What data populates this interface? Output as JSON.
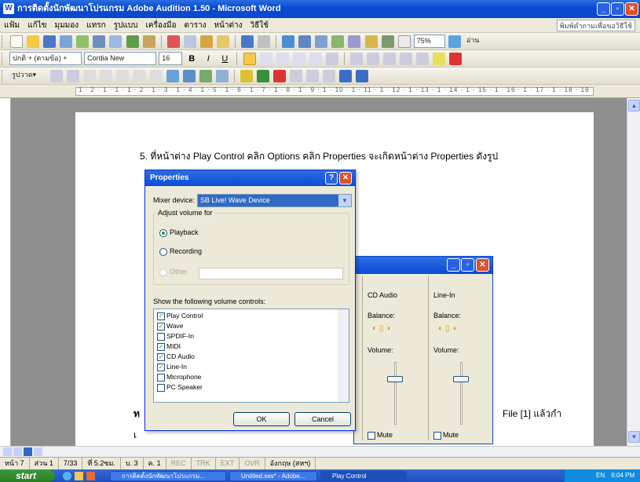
{
  "window": {
    "title": "การติดตั้งนักพัฒนาโปรแกรม Adobe Audition 1.50 - Microsoft Word",
    "help_box": "พิมพ์คำถามเพื่อขอวิธีใช้"
  },
  "menu": [
    "แฟ้ม",
    "แก้ไข",
    "มุมมอง",
    "แทรก",
    "รูปแบบ",
    "เครื่องมือ",
    "ตาราง",
    "หน้าต่าง",
    "วิธีใช้"
  ],
  "toolbar": {
    "style": "ปกติ + (ตามข้อ) + ",
    "font": "Cordia New",
    "size": "16",
    "zoom": "75%",
    "read": "อ่าน",
    "draw": "รูปวาด▾"
  },
  "ruler": "1 · 2 · 1 · 1 · 1 · 2 · 1 · 3 · 1 · 4 · 1 · 5 · 1 · 6 · 1 · 7 · 1 · 8 · 1 · 9 · 1 · 10 · 1 · 11 · 1 · 12 · 1 · 13 · 1 · 14 · 1 · 15 · 1 · 16 · 1 · 17 · 1 · 18 · 19",
  "document": {
    "instruction": "5. ที่หน้าต่าง Play Control คลิก Options คลิก Properties จะเกิดหน้าต่าง Properties ดังรูป",
    "bottom_left_1": "ท",
    "bottom_left_2": "เ",
    "bottom_right": "File [1] แล้วกำ"
  },
  "volume_window": {
    "col1_header": "CD Audio",
    "col2_header": "Line-In",
    "balance_label": "Balance:",
    "volume_label": "Volume:",
    "mute_label": "Mute"
  },
  "properties": {
    "title": "Properties",
    "mixer_label": "Mixer device:",
    "mixer_value": "SB Live! Wave Device",
    "adjust_label": "Adjust volume for",
    "radio_playback": "Playback",
    "radio_recording": "Recording",
    "radio_other": "Other",
    "show_label": "Show the following volume controls:",
    "controls": [
      {
        "label": "Play Control",
        "checked": true
      },
      {
        "label": "Wave",
        "checked": true
      },
      {
        "label": "SPDIF-In",
        "checked": false
      },
      {
        "label": "MIDI",
        "checked": true
      },
      {
        "label": "CD Audio",
        "checked": true
      },
      {
        "label": "Line-In",
        "checked": true
      },
      {
        "label": "Microphone",
        "checked": false
      },
      {
        "label": "PC Speaker",
        "checked": false
      }
    ],
    "ok": "OK",
    "cancel": "Cancel"
  },
  "status": {
    "page": "หน้า 7",
    "section": "ส่วน 1",
    "pages": "7/33",
    "at": "ที่ 5.2ซม.",
    "line": "บ. 3",
    "col": "ค. 1",
    "rec": "REC",
    "trk": "TRK",
    "ext": "EXT",
    "ovr": "OVR",
    "lang": "อังกฤษ (สหฯ)"
  },
  "taskbar": {
    "start": "start",
    "tasks": [
      "การติดตั้งนักพัฒนาโปรแกรม...",
      "Untitled.ses* - Adobe...",
      "Play Control"
    ],
    "tray": "EN",
    "clock": "6:04 PM"
  },
  "colors": {
    "titlebar": "#0a4bd6",
    "accent_green": "#21a121",
    "close_red": "#e0502a"
  }
}
